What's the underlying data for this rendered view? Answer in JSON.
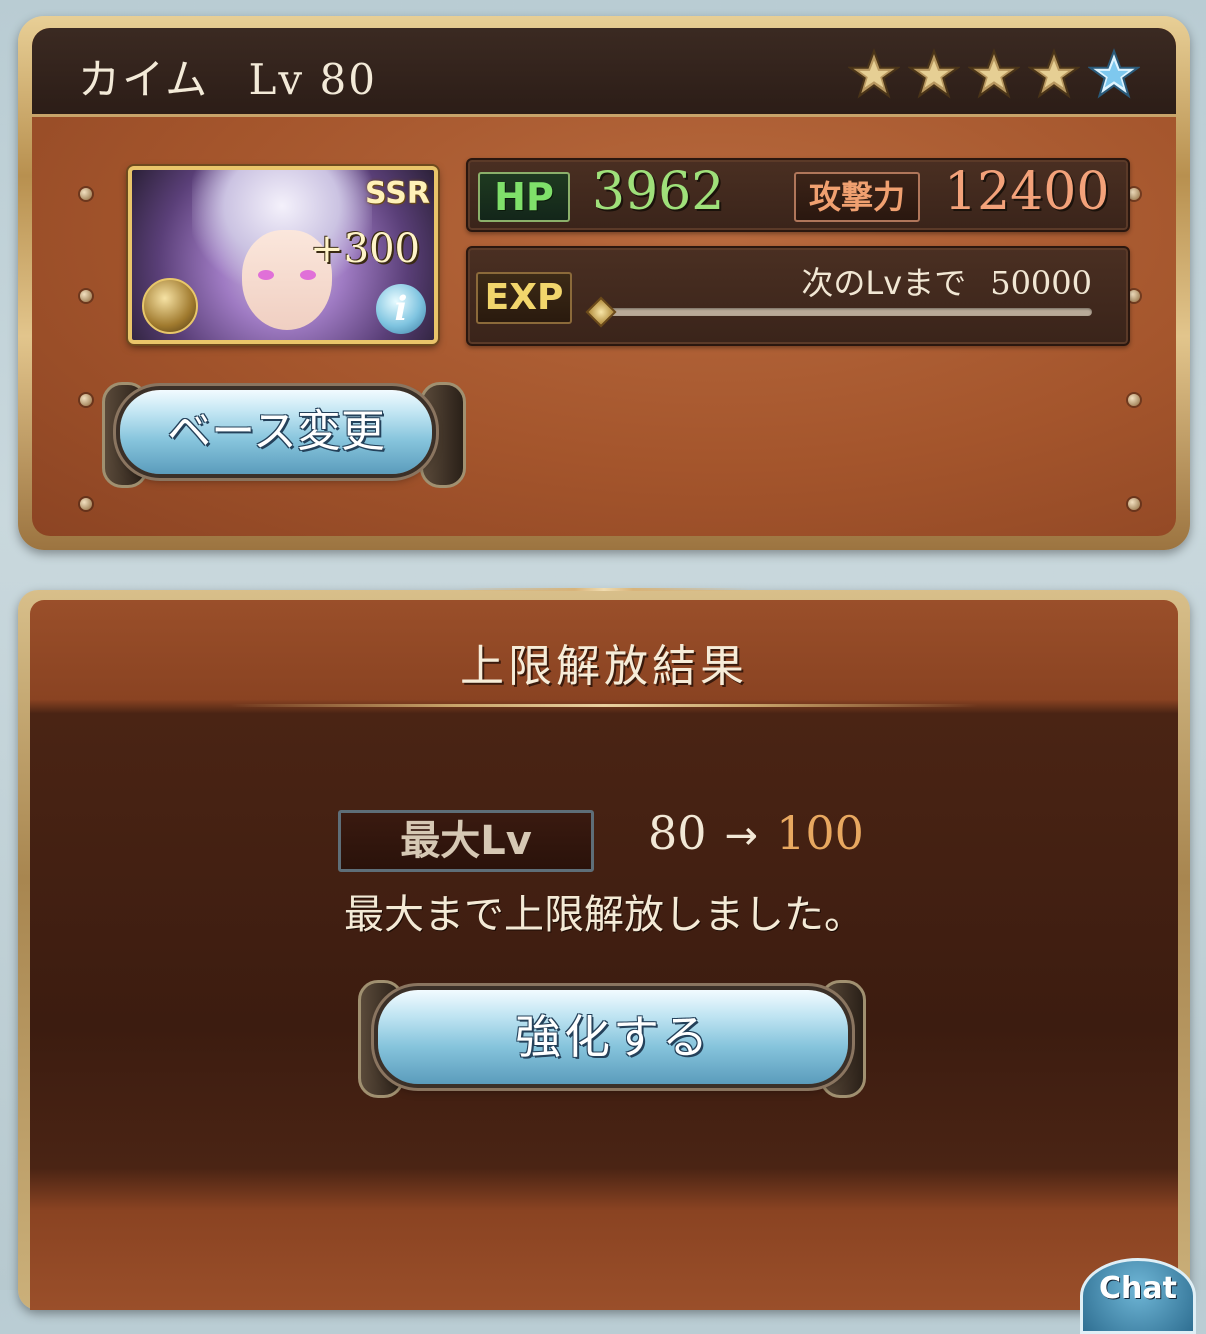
{
  "character": {
    "name": "カイム",
    "level_text": "Lv 80",
    "rarity_badge": "SSR",
    "plus_bonus": "+300",
    "stars_total": 5,
    "stars_gold": 4,
    "stars_blue": 1
  },
  "stats": {
    "hp_label": "HP",
    "hp_value": "3962",
    "atk_label": "攻撃力",
    "atk_value": "12400",
    "exp_label": "EXP",
    "next_label": "次のLvまで",
    "next_value": "50000"
  },
  "buttons": {
    "base_change": "ベース変更",
    "enhance": "強化する"
  },
  "result": {
    "title": "上限解放結果",
    "max_lv_label": "最大Lv",
    "from_level": "80",
    "arrow": "→",
    "to_level": "100",
    "message": "最大まで上限解放しました。"
  },
  "chat": {
    "label": "Chat"
  },
  "colors": {
    "hp_green": "#9fe07a",
    "atk_orange": "#f3a27a",
    "to_level": "#e8a860",
    "panel_brown": "#a4552c"
  },
  "icons": [
    "star-icon",
    "element-icon",
    "info-icon",
    "chat-icon"
  ]
}
